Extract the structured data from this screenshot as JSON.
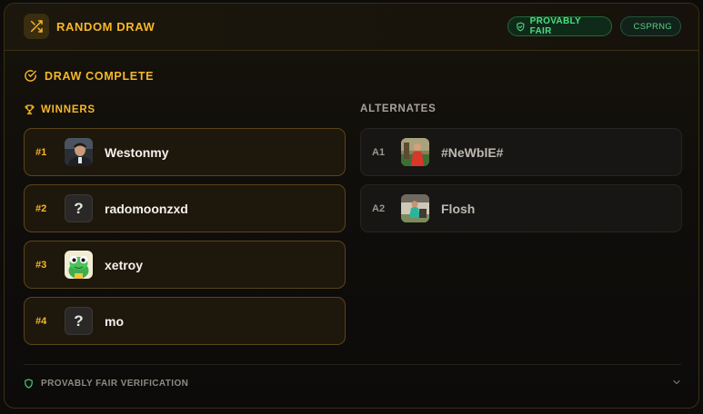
{
  "header": {
    "title": "RANDOM DRAW",
    "badges": {
      "fair": "PROVABLY FAIR",
      "csprng": "CSPRNG"
    }
  },
  "status": {
    "text": "DRAW COMPLETE"
  },
  "winners": {
    "label": "WINNERS",
    "items": [
      {
        "rank": "#1",
        "name": "Westonmy",
        "avatar": "photo"
      },
      {
        "rank": "#2",
        "name": "radomoonzxd",
        "avatar": "?"
      },
      {
        "rank": "#3",
        "name": "xetroy",
        "avatar": "frog"
      },
      {
        "rank": "#4",
        "name": "mo",
        "avatar": "?"
      }
    ]
  },
  "alternates": {
    "label": "ALTERNATES",
    "items": [
      {
        "rank": "A1",
        "name": "#NeWblE#",
        "avatar": "photo"
      },
      {
        "rank": "A2",
        "name": "Flosh",
        "avatar": "photo"
      }
    ]
  },
  "verification": {
    "label": "PROVABLY FAIR VERIFICATION"
  },
  "colors": {
    "accent": "#f5b82a",
    "success": "#4ade80"
  }
}
